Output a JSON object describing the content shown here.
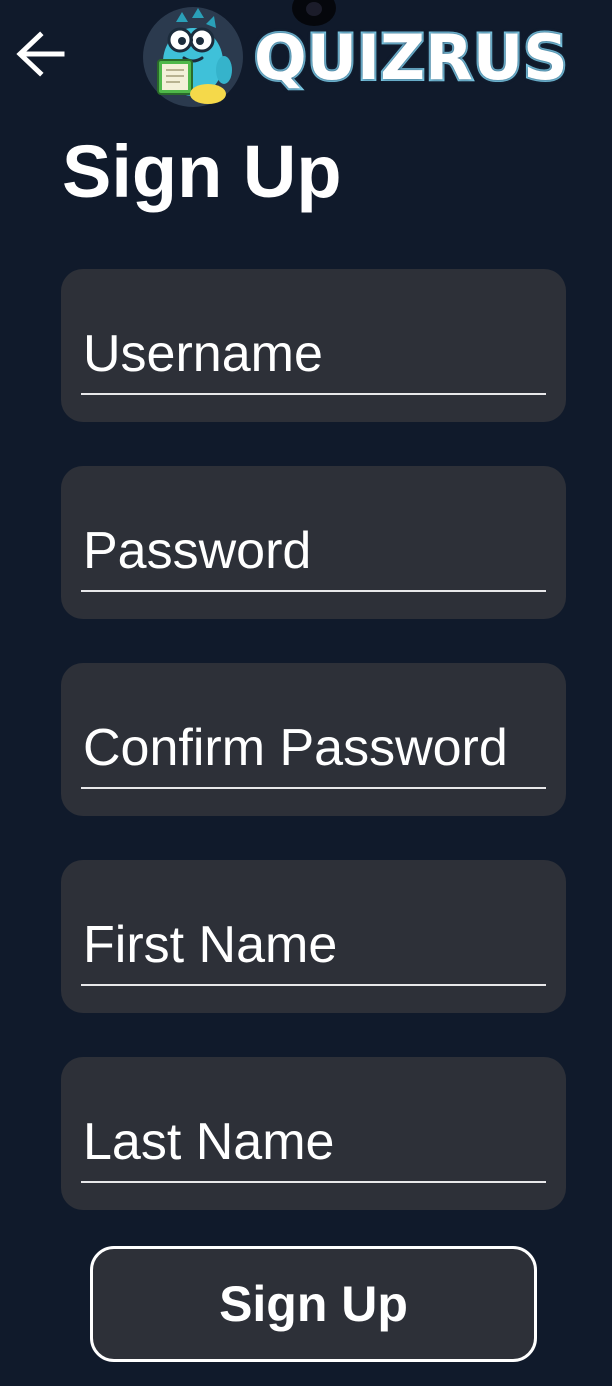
{
  "header": {
    "back_icon": "arrow-left-icon",
    "logo_text": "QUIZRUS",
    "mascot": "dinosaur-reading-book-mascot"
  },
  "page": {
    "title": "Sign Up"
  },
  "form": {
    "fields": [
      {
        "placeholder": "Username",
        "value": ""
      },
      {
        "placeholder": "Password",
        "value": ""
      },
      {
        "placeholder": "Confirm Password",
        "value": ""
      },
      {
        "placeholder": "First Name",
        "value": ""
      },
      {
        "placeholder": "Last Name",
        "value": ""
      }
    ],
    "submit_label": "Sign Up"
  },
  "colors": {
    "background": "#101a2b",
    "field_background": "#2d3038",
    "text": "#ffffff",
    "logo_outline": "#7ecde8"
  }
}
